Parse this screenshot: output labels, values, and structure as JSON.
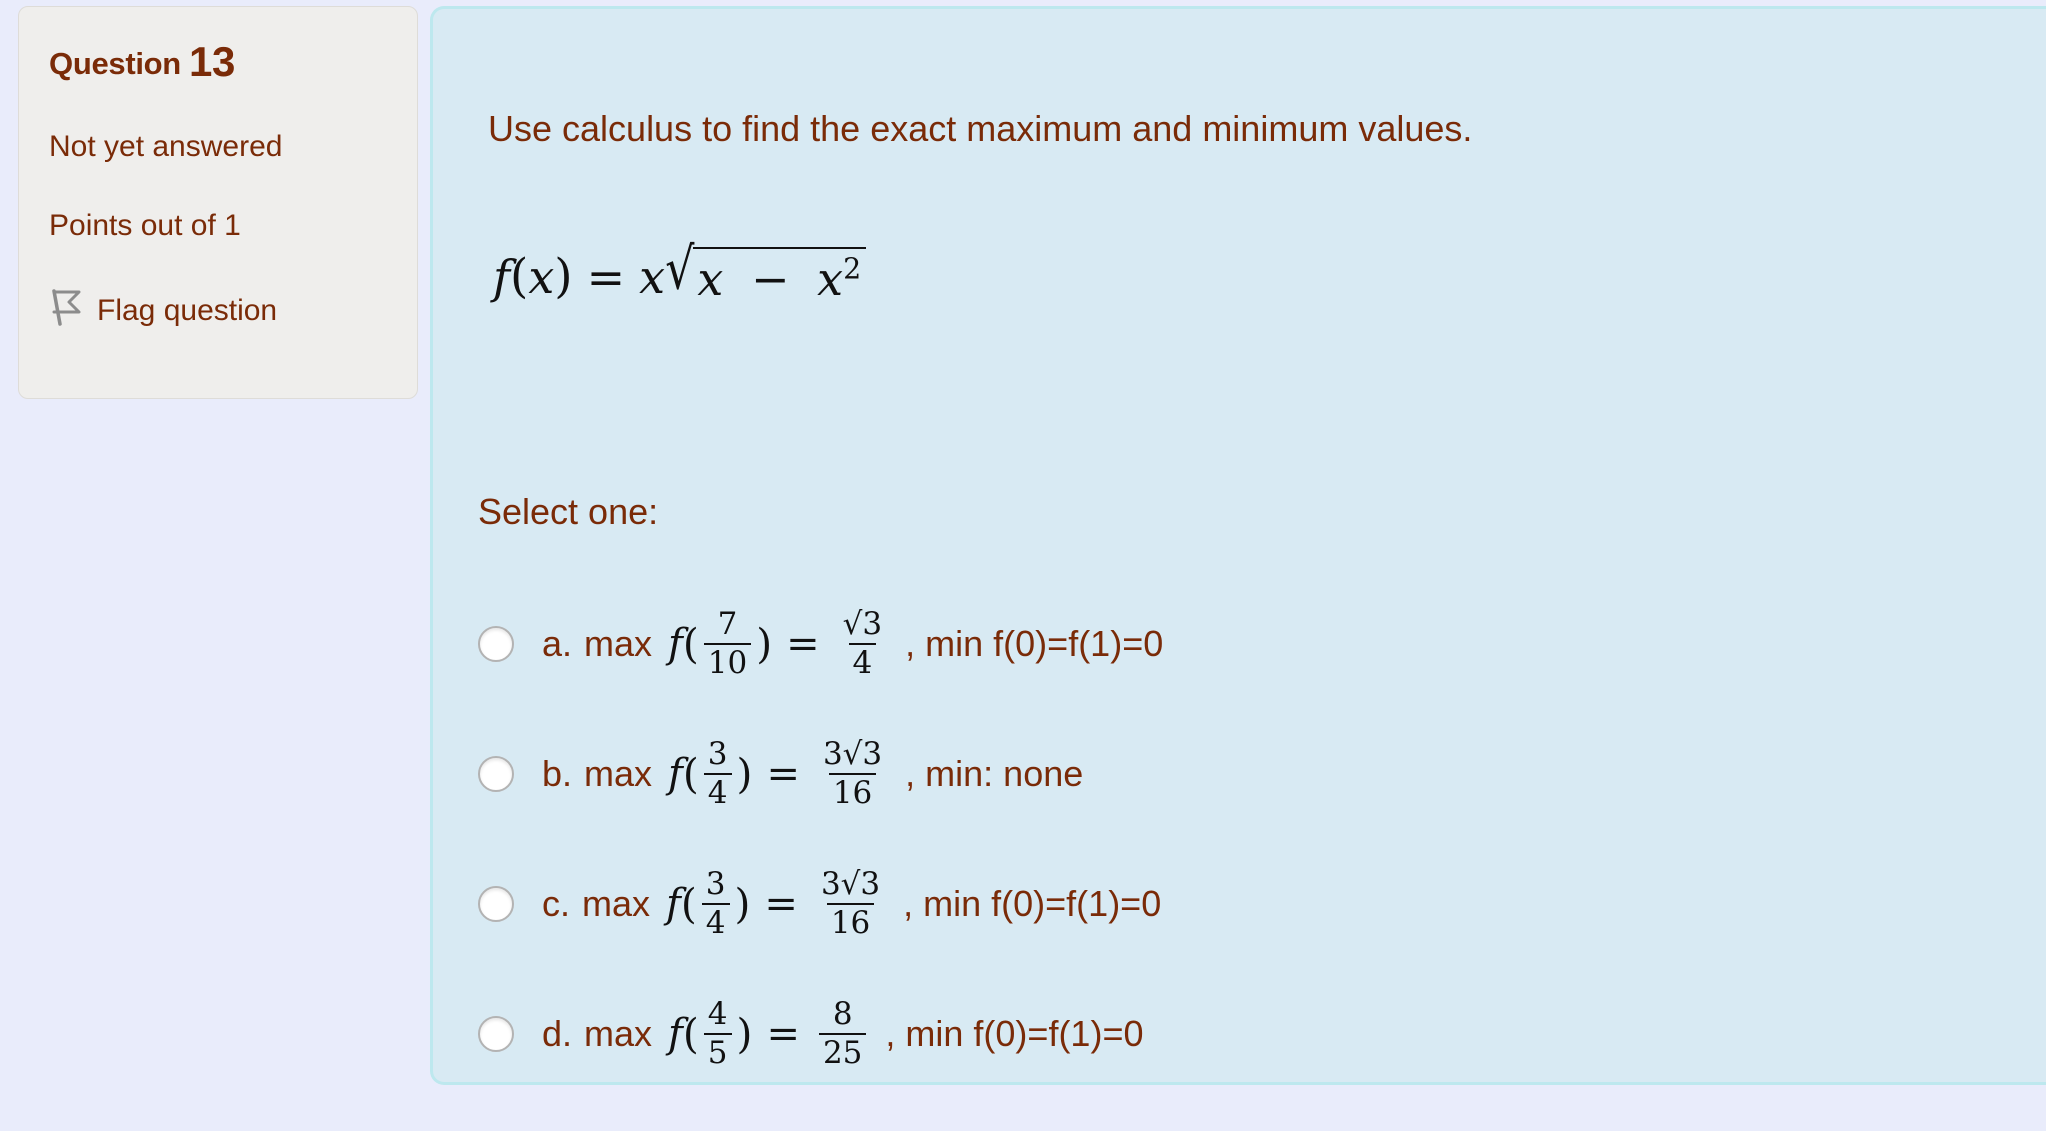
{
  "sidebar": {
    "question_label": "Question",
    "question_number": "13",
    "state": "Not yet answered",
    "points": "Points out of 1",
    "flag_label": "Flag question",
    "flag_icon": "flag-outline-icon"
  },
  "content": {
    "stem": "Use calculus to find the exact maximum and minimum values.",
    "formula": {
      "lhs_f": "f",
      "lhs_var": "x",
      "equals": "=",
      "coeff": "x",
      "radical": "√",
      "radicand_a": "x",
      "minus": "−",
      "radicand_b": "x",
      "radicand_b_exp": "2"
    },
    "select_one_label": "Select one:"
  },
  "options": [
    {
      "letter": "a.",
      "maxword": "max",
      "fn": "f",
      "arg_num": "7",
      "arg_den": "10",
      "equals": "=",
      "value_num": "√3",
      "value_den": "4",
      "tail": ", min f(0)=f(1)=0",
      "selected": false
    },
    {
      "letter": "b.",
      "maxword": "max",
      "fn": "f",
      "arg_num": "3",
      "arg_den": "4",
      "equals": "=",
      "value_num": "3√3",
      "value_den": "16",
      "tail": ", min: none",
      "selected": false
    },
    {
      "letter": "c.",
      "maxword": "max",
      "fn": "f",
      "arg_num": "3",
      "arg_den": "4",
      "equals": "=",
      "value_num": "3√3",
      "value_den": "16",
      "tail": ", min f(0)=f(1)=0",
      "selected": false
    },
    {
      "letter": "d.",
      "maxword": "max",
      "fn": "f",
      "arg_num": "4",
      "arg_den": "5",
      "equals": "=",
      "value_num": "8",
      "value_den": "25",
      "tail": ", min f(0)=f(1)=0",
      "selected": false
    }
  ],
  "colors": {
    "page_background": "#e9ecfb",
    "info_box_background": "#efeeec",
    "content_panel_background": "#d8eaf3",
    "content_panel_border": "#bde8ee",
    "text_maroon": "#7a2b08",
    "math_black": "#111111"
  }
}
